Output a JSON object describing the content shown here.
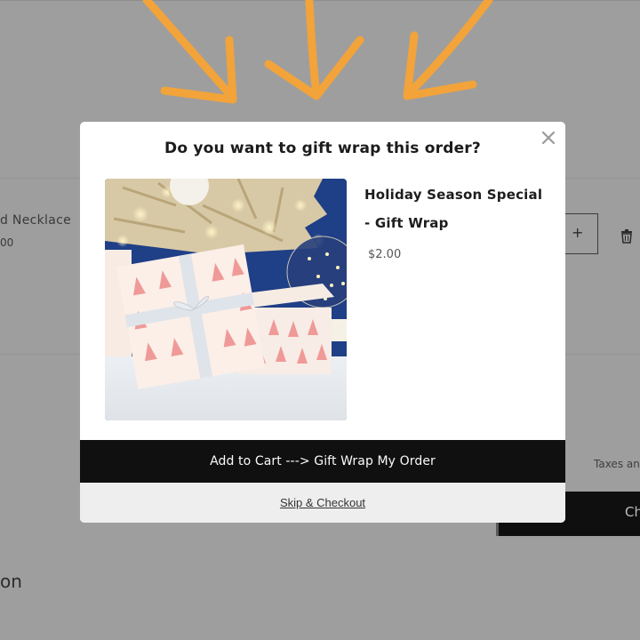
{
  "background": {
    "product_name": "d Necklace",
    "product_price": "00",
    "qty_plus": "+",
    "taxes_text": "Taxes and",
    "checkout_label": "Che",
    "section_title": "on"
  },
  "modal": {
    "title": "Do you want to gift wrap this order?",
    "close_icon": "×",
    "product": {
      "title": "Holiday Season Special - Gift Wrap",
      "price": "$2.00"
    },
    "add_button_label": "Add to Cart ---> Gift Wrap My Order",
    "skip_label": "Skip & Checkout"
  },
  "colors": {
    "overlay": "#9e9e9e",
    "arrow": "#f2a33a",
    "button_bg": "#101010",
    "skip_bg": "#eeeeee",
    "wrap_pink": "#f4a9a8",
    "backdrop_blue": "#1f3f86"
  }
}
